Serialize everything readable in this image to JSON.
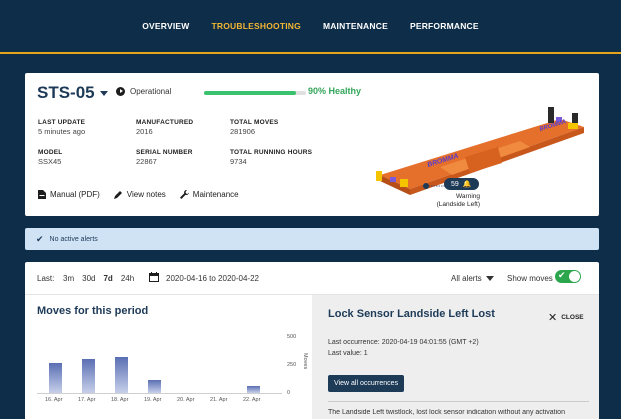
{
  "nav": {
    "tabs": [
      "OVERVIEW",
      "TROUBLESHOOTING",
      "MAINTENANCE",
      "PERFORMANCE"
    ],
    "active": 1
  },
  "equipment": {
    "name": "STS-05",
    "status": "Operational",
    "health_percent": 90,
    "health_label": "90% Healthy",
    "fields": [
      {
        "label": "LAST UPDATE",
        "value": "5 minutes ago"
      },
      {
        "label": "MANUFACTURED",
        "value": "2016"
      },
      {
        "label": "TOTAL MOVES",
        "value": "281906"
      },
      {
        "label": "MODEL",
        "value": "SSX45"
      },
      {
        "label": "SERIAL NUMBER",
        "value": "22867"
      },
      {
        "label": "TOTAL RUNNING HOURS",
        "value": "9734"
      }
    ],
    "links": [
      "Manual (PDF)",
      "View notes",
      "Maintenance"
    ],
    "warning_count": "59",
    "warning_title": "Warning",
    "warning_location": "(Landside Left)",
    "crane_brand": "BROMMA"
  },
  "alerts": {
    "text": "No active alerts"
  },
  "filter": {
    "label": "Last:",
    "ranges": [
      "3m",
      "30d",
      "7d",
      "24h"
    ],
    "selected": "7d",
    "date_range": "2020-04-16 to 2020-04-22",
    "alerts_select": "All alerts",
    "show_moves_label": "Show moves",
    "show_moves": true
  },
  "moves": {
    "title": "Moves for this period",
    "y_axis_title": "Moves"
  },
  "chart_data": {
    "type": "bar",
    "title": "Moves for this period",
    "categories": [
      "16. Apr",
      "17. Apr",
      "18. Apr",
      "19. Apr",
      "20. Apr",
      "21. Apr",
      "22. Apr"
    ],
    "values": [
      265,
      300,
      325,
      115,
      0,
      0,
      60
    ],
    "ylabel": "Moves",
    "yticks": [
      0,
      250,
      500
    ],
    "ylim": [
      0,
      500
    ],
    "y_axis_position": "right",
    "colors": {
      "bar_top": "#5a6fb3",
      "bar_bottom": "#c7d0ea"
    }
  },
  "detail": {
    "title": "Lock Sensor Landside Left Lost",
    "close_label": "CLOSE",
    "last_occurrence": "Last occurrence: 2020-04-19 04:01:55 (GMT +2)",
    "last_value": "Last value: 1",
    "button_label": "View all occurrences",
    "description": "The Landside Left twistlock, lost lock sensor indication without any activation"
  },
  "colors": {
    "nav_bg": "#0d2d48",
    "accent": "#f2b632",
    "primary": "#1d3a57",
    "healthy": "#3bc26e"
  }
}
